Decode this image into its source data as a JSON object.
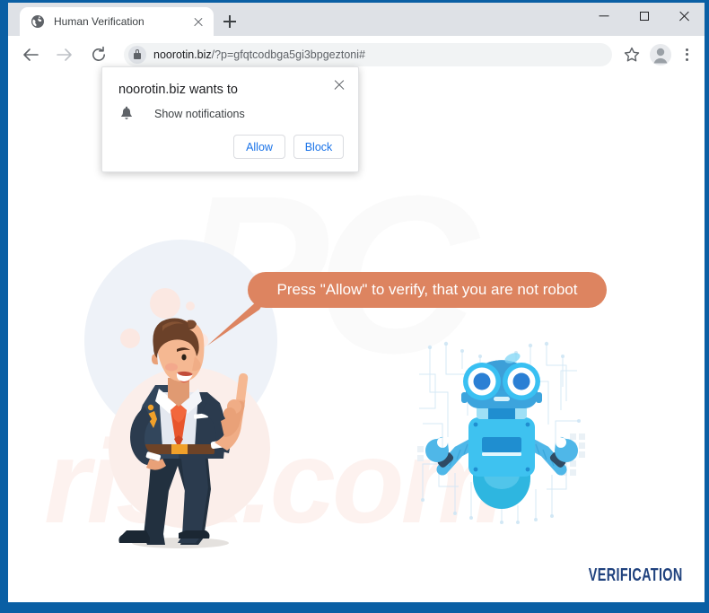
{
  "window": {
    "controls": {
      "minimize": "minimize-button",
      "maximize": "maximize-button",
      "close": "close-button"
    }
  },
  "tabs": {
    "active": {
      "title": "Human Verification",
      "favicon": "globe-icon",
      "close_label": "×"
    },
    "new_tab_label": "+"
  },
  "toolbar": {
    "back_icon": "arrow-left-icon",
    "forward_icon": "arrow-right-icon",
    "reload_icon": "reload-icon",
    "lock_icon": "lock-icon",
    "url_host": "noorotin.biz",
    "url_path": "/?p=gfqtcodbga5gi3bpgeztoni#",
    "star_icon": "star-icon",
    "profile_icon": "profile-avatar-icon",
    "menu_icon": "three-dot-menu-icon"
  },
  "permission_dialog": {
    "title": "noorotin.biz wants to",
    "request_icon": "bell-icon",
    "request_label": "Show notifications",
    "allow_label": "Allow",
    "block_label": "Block",
    "close_label": "×"
  },
  "page": {
    "bubble_text": "Press \"Allow\" to verify, that you are not robot",
    "footer_label": "VERIFICATION",
    "watermark_top": "PC",
    "watermark_bottom": "risk.com",
    "man_illustration": "pointing-businessman-illustration",
    "robot_illustration": "blue-robot-illustration"
  },
  "colors": {
    "window_frame": "#0a5fa4",
    "tabstrip": "#dee1e6",
    "omnibox": "#f1f3f4",
    "bubble": "#dd8460",
    "button_text": "#1a73e8",
    "footer": "#20427e",
    "blob_blue": "#eef2f8",
    "blob_pink": "#fbeeea",
    "suit": "#2b3b4e",
    "tie": "#e8552c",
    "robot_body": "#3ec2f0"
  }
}
